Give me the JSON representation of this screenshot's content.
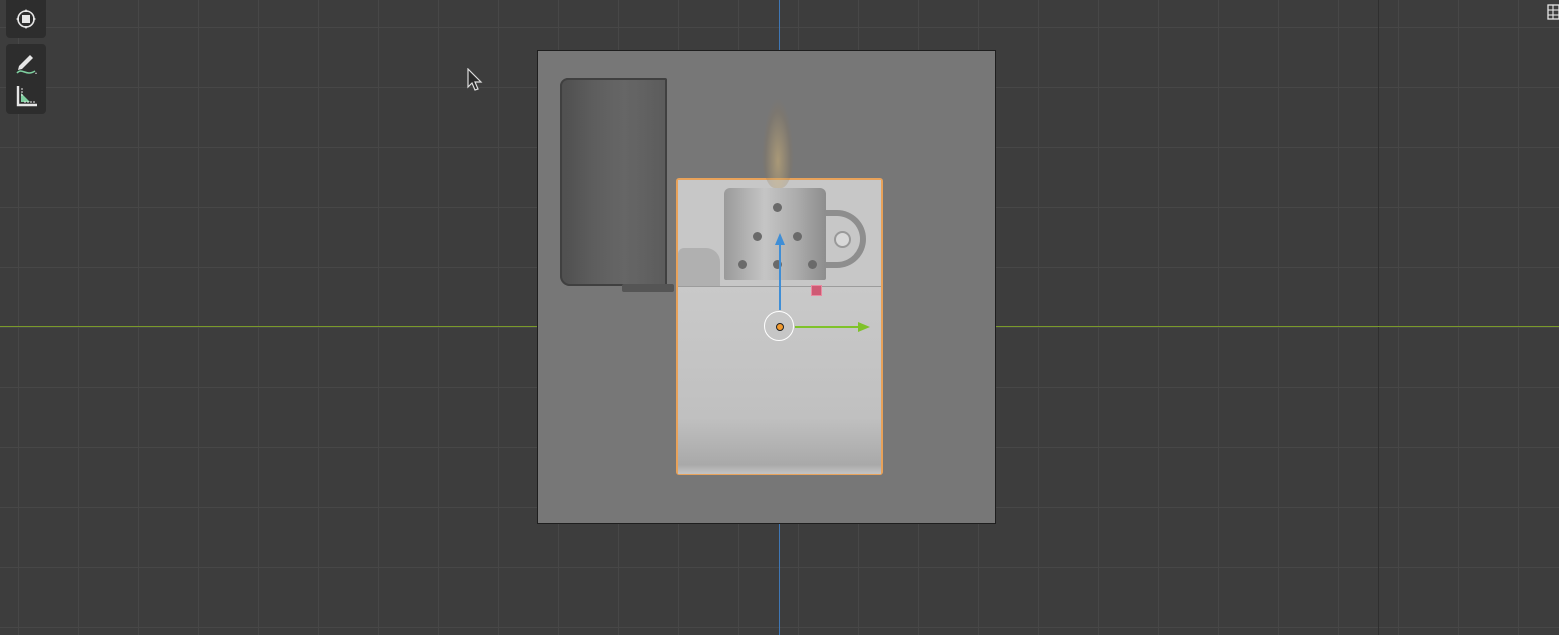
{
  "app": "3D viewport",
  "toolbar": {
    "tools": [
      {
        "name": "transform",
        "icon": "transform-icon"
      },
      {
        "name": "annotate",
        "icon": "annotate-icon"
      },
      {
        "name": "measure",
        "icon": "measure-icon"
      }
    ]
  },
  "viewport": {
    "background": "#3d3d3d",
    "x_axis_color": "#7a9a2b",
    "y_axis_color": "#3f77b5",
    "selection_outline_color": "#e8a25a",
    "reference_image": "zippo-lighter-icon",
    "active_object_origin_color": "#f29a2e"
  },
  "gizmo": {
    "z_arrow_color": "#3f8ed6",
    "x_arrow_color": "#7fc22a",
    "plane_handle_color": "#cf5a74"
  }
}
